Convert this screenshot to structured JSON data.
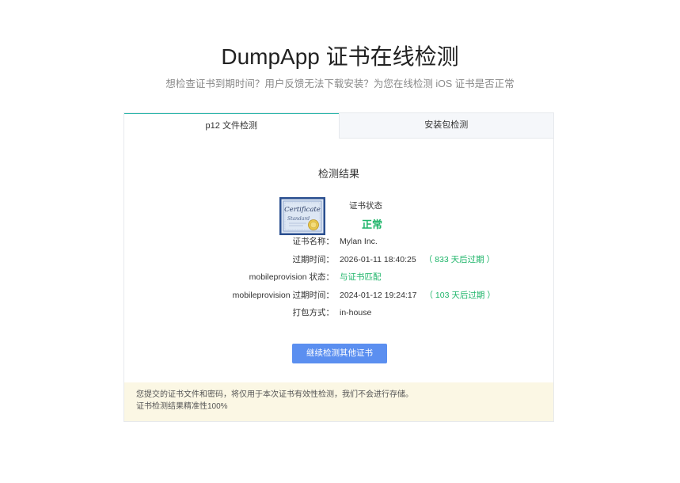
{
  "header": {
    "title": "DumpApp 证书在线检测",
    "subtitle": "想检查证书到期时间？用户反馈无法下载安装？为您在线检测 iOS 证书是否正常"
  },
  "tabs": [
    {
      "label": "p12 文件检测",
      "active": true
    },
    {
      "label": "安装包检测",
      "active": false
    }
  ],
  "result": {
    "title": "检测结果",
    "certificate_image": {
      "icon": "certificate-image",
      "script_text": "Certificate",
      "sub_text": "Standard"
    },
    "status_label": "证书状态",
    "status_value": "正常",
    "rows": [
      {
        "label": "证书名称：",
        "value": "Mylan Inc.",
        "note": ""
      },
      {
        "label": "过期时间：",
        "value": "2026-01-11 18:40:25",
        "note": "（ 833 天后过期 ）"
      },
      {
        "label": "mobileprovision 状态：",
        "value": "与证书匹配",
        "note": ""
      },
      {
        "label": "mobileprovision 过期时间：",
        "value": "2024-01-12 19:24:17",
        "note": "（ 103 天后过期 ）"
      },
      {
        "label": "打包方式：",
        "value": "in-house",
        "note": ""
      }
    ],
    "continue_button": "继续检测其他证书"
  },
  "notice": {
    "line1": "您提交的证书文件和密码，将仅用于本次证书有效性检测，我们不会进行存储。",
    "line2": "证书检测结果精准性100%"
  },
  "colors": {
    "accent_tab": "#26b5a8",
    "success_green": "#1fb56a",
    "button_blue": "#5b8ff0",
    "notice_bg": "#fbf7e4"
  }
}
